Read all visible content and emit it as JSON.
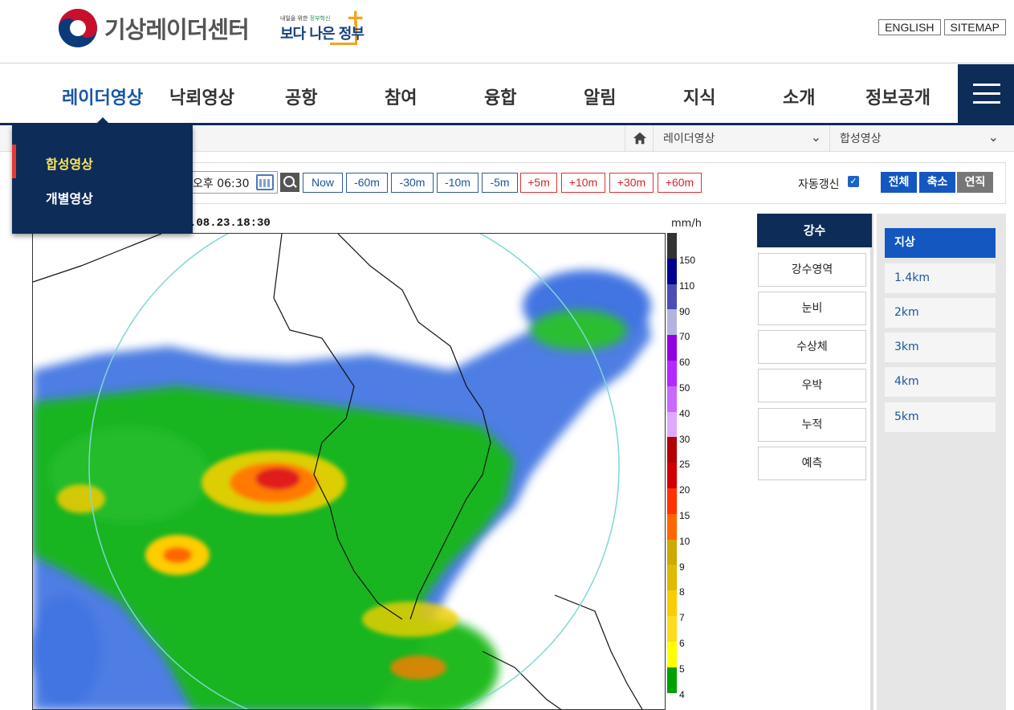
{
  "header": {
    "site_name": "기상레이더센터",
    "gov_small_prefix": "내일을 위한 ",
    "gov_small_highlight": "정부혁신",
    "gov_big": "보다 나은 정부",
    "lang_buttons": [
      "ENGLISH",
      "SITEMAP"
    ]
  },
  "nav": {
    "items": [
      "레이더영상",
      "낙뢰영상",
      "공항",
      "참여",
      "융합",
      "알림",
      "지식",
      "소개",
      "정보공개"
    ],
    "active_index": 0
  },
  "dropdown": {
    "items": [
      "합성영상",
      "개별영상"
    ],
    "active_index": 0
  },
  "breadcrumb": {
    "level1": "레이더영상",
    "level2": "합성영상"
  },
  "toolbar": {
    "time_value": "오후 06:30",
    "buttons_blue": [
      "Now",
      "-60m",
      "-30m",
      "-10m",
      "-5m"
    ],
    "buttons_red": [
      "+5m",
      "+10m",
      "+30m",
      "+60m"
    ],
    "auto_refresh_label": "자동갱신",
    "auto_refresh_checked": true,
    "view_buttons": [
      "전체",
      "축소",
      "연직"
    ]
  },
  "radar": {
    "timestamp": ".08.23.18:30",
    "unit": "mm/h",
    "legend_labels": [
      "150",
      "110",
      "90",
      "70",
      "60",
      "50",
      "40",
      "30",
      "25",
      "20",
      "15",
      "10",
      "9",
      "8",
      "7",
      "6",
      "5",
      "4"
    ],
    "legend_colors": [
      "#333333",
      "#000090",
      "#4c4eb1",
      "#b3b4de",
      "#9300e4",
      "#b329ff",
      "#c969ff",
      "#e0a9ff",
      "#b40000",
      "#d20000",
      "#ff3200",
      "#ff6600",
      "#ccaa00",
      "#e0b900",
      "#f9cd00",
      "#ffdc1f",
      "#ffff00",
      "#00a000"
    ]
  },
  "precip_panel": {
    "header": "강수",
    "items": [
      "강수영역",
      "눈비",
      "수상체",
      "우박",
      "누적",
      "예측"
    ]
  },
  "altitude_panel": {
    "items": [
      "지상",
      "1.4km",
      "2km",
      "3km",
      "4km",
      "5km"
    ],
    "active_index": 0
  },
  "colors": {
    "navy": "#0d2c57",
    "accent_blue": "#1557a6",
    "red": "#d22222"
  }
}
